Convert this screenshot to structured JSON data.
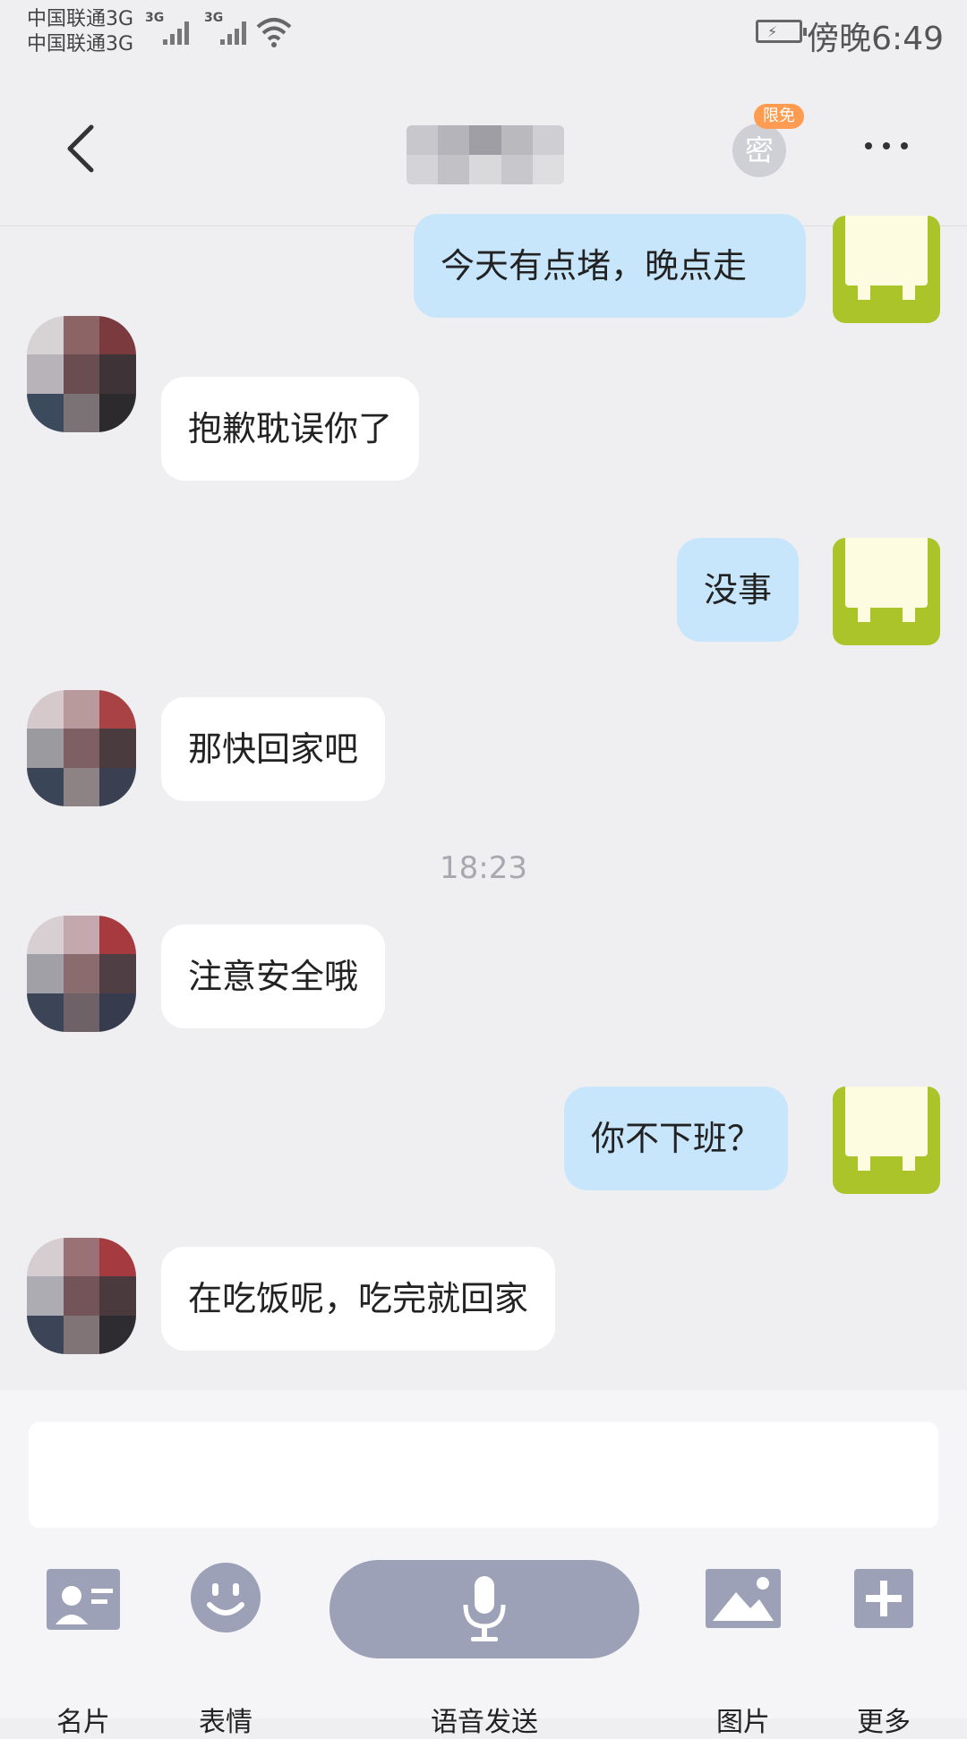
{
  "status_bar": {
    "carrier_1": "中国联通3G",
    "carrier_2": "中国联通3G",
    "network_1": "3G",
    "network_2": "3G",
    "time": "傍晚6:49"
  },
  "header": {
    "back_icon": "chevron-left-icon",
    "secret_chat_label": "密",
    "secret_badge": "限免",
    "more_icon": "more-dots-icon"
  },
  "messages": [
    {
      "side": "out",
      "text": "今天有点堵，晚点走"
    },
    {
      "side": "in",
      "text": "抱歉耽误你了"
    },
    {
      "side": "out",
      "text": "没事"
    },
    {
      "side": "in",
      "text": "那快回家吧"
    },
    {
      "timestamp": "18:23"
    },
    {
      "side": "in",
      "text": "注意安全哦"
    },
    {
      "side": "out",
      "text": "你不下班？"
    },
    {
      "side": "in",
      "text": "在吃饭呢，吃完就回家"
    }
  ],
  "toolbar": {
    "card_label": "名片",
    "emoji_label": "表情",
    "voice_label": "语音发送",
    "image_label": "图片",
    "more_label": "更多"
  },
  "colors": {
    "outgoing_bubble": "#c8e6fb",
    "incoming_bubble": "#ffffff",
    "background": "#efeff2",
    "toolbar_icon": "#9da1b8",
    "own_avatar": "#aac42a",
    "badge": "#ff9c52"
  }
}
